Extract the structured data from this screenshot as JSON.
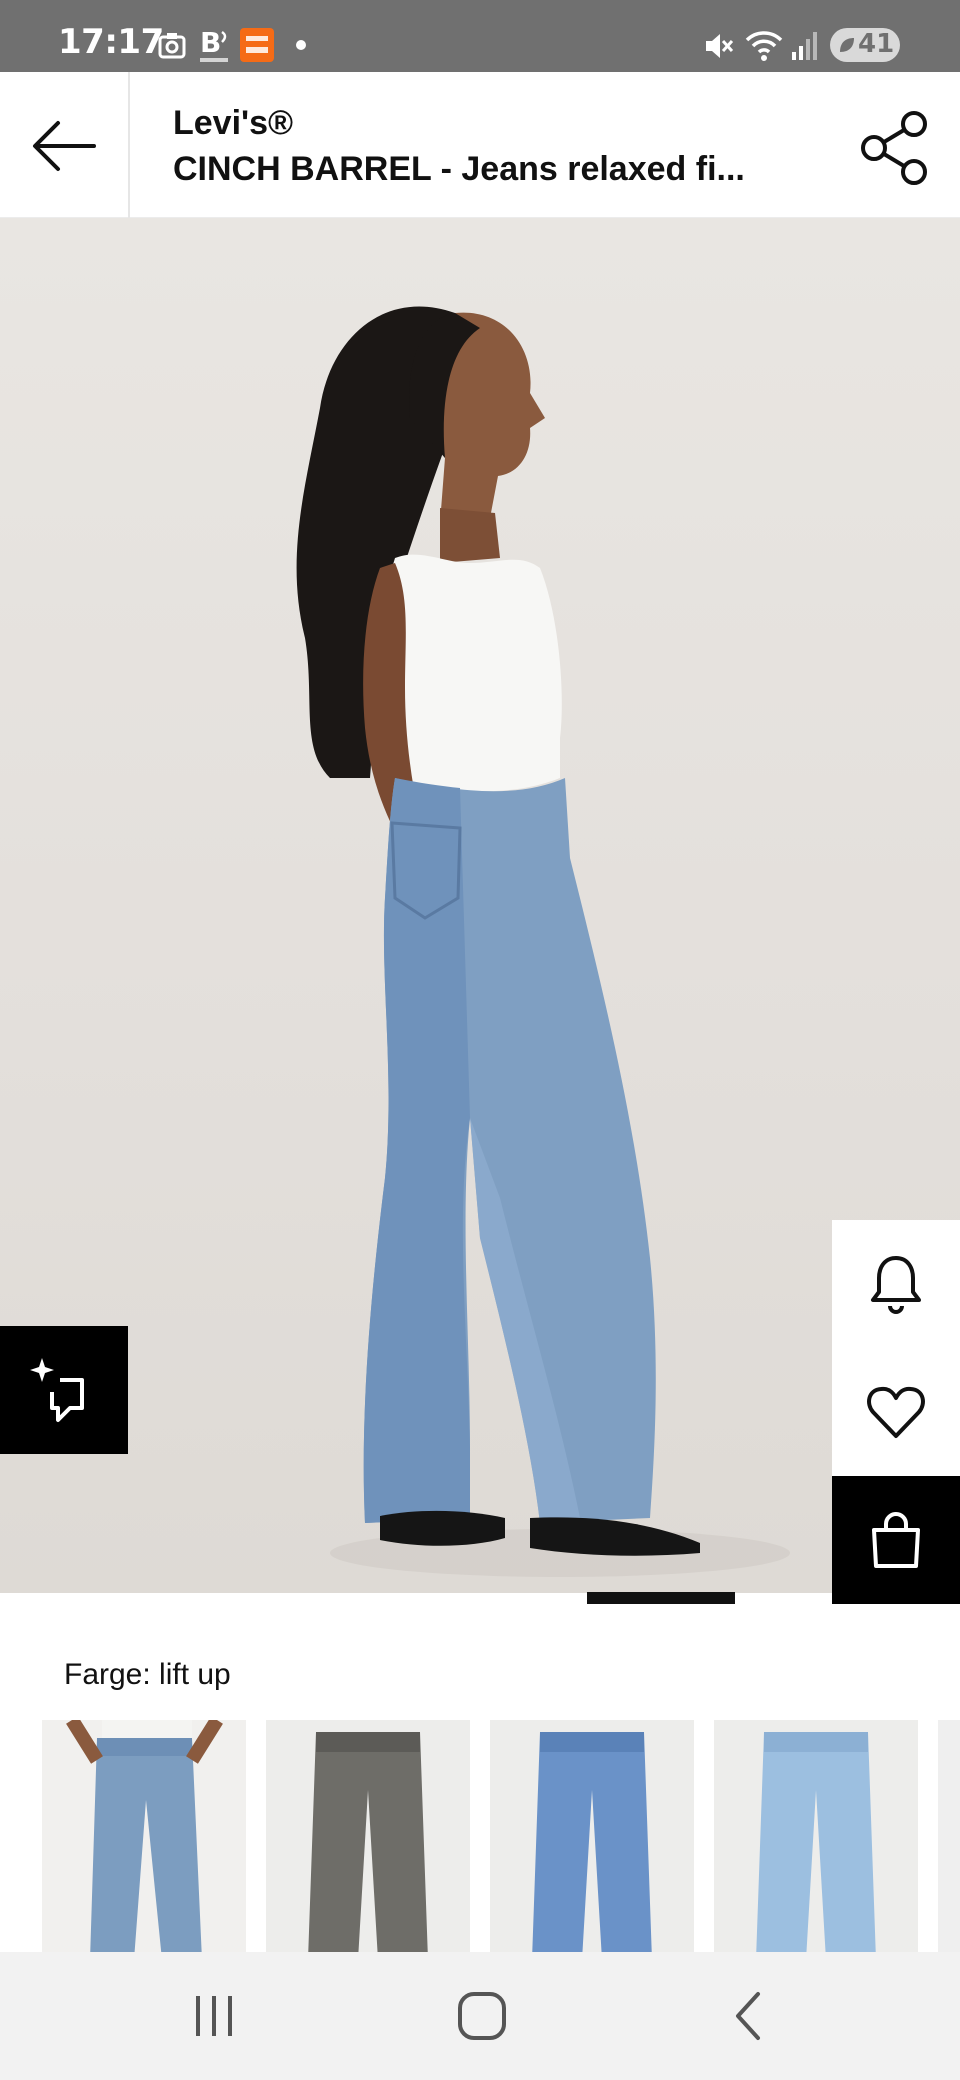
{
  "status_bar": {
    "time": "17:17",
    "battery_level": "41",
    "icons": [
      "screenshot-icon",
      "b-app-icon",
      "temu-app-icon",
      "notification-dot-icon",
      "mute-icon",
      "wifi-icon",
      "signal-icon",
      "battery-saver-icon"
    ]
  },
  "header": {
    "brand": "Levi's®",
    "title": "CINCH BARREL - Jeans relaxed fi..."
  },
  "product": {
    "image_icon": "product-photo",
    "carousel_position": 0.6
  },
  "side_actions": [
    {
      "name": "notify",
      "icon": "bell-icon"
    },
    {
      "name": "wishlist",
      "icon": "heart-icon"
    },
    {
      "name": "bag",
      "icon": "shopping-bag-icon"
    }
  ],
  "similar_button": {
    "icon": "sparkle-crop-icon"
  },
  "color": {
    "label": "Farge: lift up",
    "swatches": [
      {
        "name": "lift up",
        "tone": "#7c9dc0",
        "selected": true
      },
      {
        "name": "grey",
        "tone": "#6e6d68",
        "selected": false
      },
      {
        "name": "mid blue",
        "tone": "#6a92c8",
        "selected": false
      },
      {
        "name": "light blue",
        "tone": "#9cbfe0",
        "selected": false
      }
    ]
  },
  "nav_bar": {
    "icons": [
      "recent-apps-icon",
      "home-icon",
      "back-nav-icon"
    ]
  },
  "colors": {
    "status_bar_bg": "#707070",
    "image_bg": "#e6e2de",
    "accent": "#000000"
  }
}
